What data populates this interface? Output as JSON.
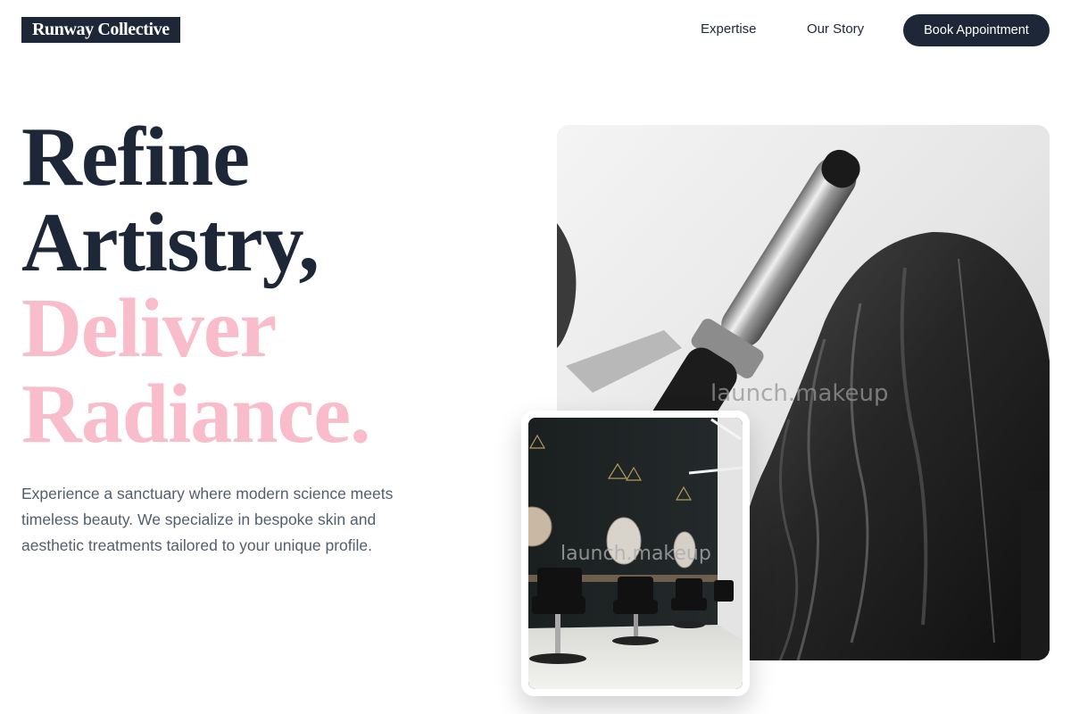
{
  "brand": {
    "name": "Runway Collective"
  },
  "nav": {
    "links": [
      {
        "label": "Expertise"
      },
      {
        "label": "Our Story"
      }
    ],
    "cta_label": "Book Appointment"
  },
  "hero": {
    "headline_lines": [
      "Refine",
      "Artistry,",
      "Deliver",
      "Radiance."
    ],
    "intro": "Experience a sanctuary where modern science meets timeless beauty. We specialize in bespoke skin and aesthetic treatments tailored to your unique profile.",
    "main_image": {
      "subject": "hair styling with curling iron",
      "watermark": "launch.makeup"
    },
    "inset_image": {
      "subject": "salon interior with chairs and round mirrors",
      "watermark": "launch.makeup"
    }
  },
  "colors": {
    "navy": "#1e2738",
    "pink": "#f8bccb",
    "body_text": "#535e6d",
    "background": "#ffffff"
  }
}
